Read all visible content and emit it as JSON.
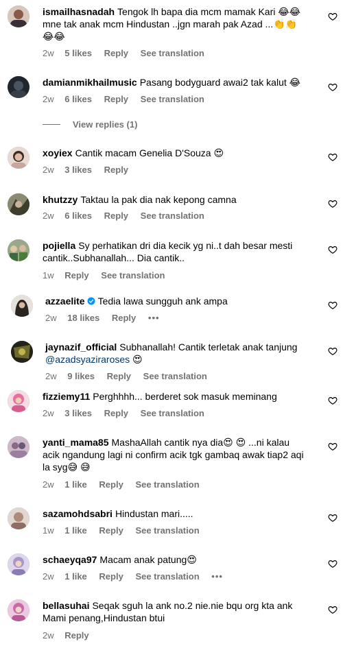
{
  "comments": [
    {
      "user": "ismailhasnadah",
      "text": "Tengok lh bapa dia mcm mamak Kari 😂😂 mne tak anak mcm Hindustan ..jgn marah pak Azad ...👏👏😂😂",
      "time": "2w",
      "likes": "5 likes",
      "reply": "Reply",
      "translate": "See translation",
      "avatar_color": "#b98a7a"
    },
    {
      "user": "damianmikhailmusic",
      "text": "Pasang bodyguard awai2 tak kalut 😂",
      "time": "2w",
      "likes": "6 likes",
      "reply": "Reply",
      "translate": "See translation",
      "avatar_color": "#2d3640"
    },
    {
      "user": "xoyiex",
      "text": "Cantik macam Genelia D'Souza 😍",
      "time": "2w",
      "likes": "3 likes",
      "reply": "Reply",
      "avatar_color": "#c9a79a"
    },
    {
      "user": "khutzzy",
      "text": "Taktau la pak dia nak kepong camna",
      "time": "2w",
      "likes": "6 likes",
      "reply": "Reply",
      "translate": "See translation",
      "avatar_color": "#5a5a48"
    },
    {
      "user": "pojiella",
      "text": "Sy perhatikan dri dia kecik yg ni..t dah besar mesti cantik..Subhanallah... Dia cantik..",
      "time": "1w",
      "reply": "Reply",
      "translate": "See translation",
      "avatar_color": "#6f8a5a"
    },
    {
      "user": "azzaelite",
      "text": "Tedia lawa sungguh ank ampa",
      "time": "2w",
      "likes": "18 likes",
      "reply": "Reply",
      "more": "•••",
      "avatar_color": "#2a2420",
      "verified": true
    },
    {
      "user": "jaynazif_official",
      "text": "Subhanallah! Cantik terletak anak tanjung",
      "mention": "@azadsyaziraroses",
      "after_mention": " 😍",
      "time": "2w",
      "likes": "9 likes",
      "reply": "Reply",
      "translate": "See translation",
      "avatar_color": "#3a3a20"
    },
    {
      "user": "fizziemy11",
      "text": "Perghhhh... berderet sok masuk meminang",
      "time": "2w",
      "likes": "3 likes",
      "reply": "Reply",
      "translate": "See translation",
      "avatar_color": "#e7a8c0"
    },
    {
      "user": "yanti_mama85",
      "text": "MashaAllah cantik nya dia😍 😍 ...ni kalau acik ngandung lagi ni confirm acik tgk gambaq awak tiap2 aqi la syg😅 😅",
      "time": "2w",
      "likes": "1 like",
      "reply": "Reply",
      "translate": "See translation",
      "avatar_color": "#a7889a"
    },
    {
      "user": "sazamohdsabri",
      "text": "Hindustan mari.....",
      "time": "1w",
      "likes": "1 like",
      "reply": "Reply",
      "translate": "See translation",
      "avatar_color": "#c9b2a8"
    },
    {
      "user": "schaeyqa97",
      "text": "Macam anak patung😍",
      "time": "2w",
      "likes": "1 like",
      "reply": "Reply",
      "translate": "See translation",
      "more": "•••",
      "avatar_color": "#b3a2c4"
    },
    {
      "user": "bellasuhai",
      "text": "Seqak sguh la ank no.2 nie.nie bqu org kta ank Mami penang,Hindustan btui",
      "time": "2w",
      "reply": "Reply",
      "avatar_color": "#c98ab8"
    }
  ],
  "view_replies": "View replies (1)",
  "colors": {
    "secondary": "#737373",
    "mention": "#00376b",
    "verified": "#0095f6"
  },
  "icons": {
    "like": "heart-outline-icon",
    "verified": "verified-badge-icon"
  }
}
